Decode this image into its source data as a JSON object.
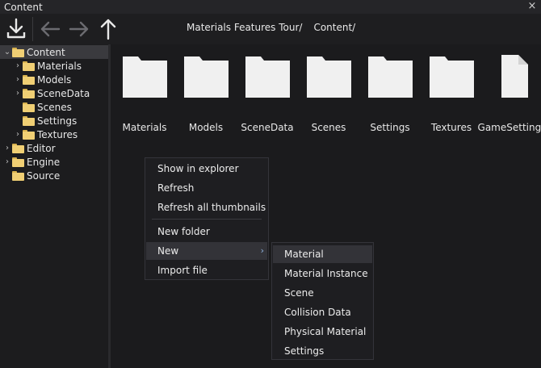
{
  "window": {
    "title": "Content",
    "close_glyph": "×"
  },
  "toolbar": {
    "icons": [
      "import-icon",
      "arrow-left-icon",
      "arrow-right-icon",
      "arrow-up-icon"
    ],
    "breadcrumbs": [
      "Materials Features Tour/",
      "Content/"
    ]
  },
  "tree": [
    {
      "label": "Content",
      "expanded": true,
      "selected": true
    },
    {
      "label": "Materials"
    },
    {
      "label": "Models"
    },
    {
      "label": "SceneData"
    },
    {
      "label": "Scenes"
    },
    {
      "label": "Settings"
    },
    {
      "label": "Textures"
    },
    {
      "label": "Editor"
    },
    {
      "label": "Engine"
    },
    {
      "label": "Source"
    }
  ],
  "items": [
    {
      "label": "Materials",
      "kind": "folder"
    },
    {
      "label": "Models",
      "kind": "folder"
    },
    {
      "label": "SceneData",
      "kind": "folder"
    },
    {
      "label": "Scenes",
      "kind": "folder"
    },
    {
      "label": "Settings",
      "kind": "folder"
    },
    {
      "label": "Textures",
      "kind": "folder"
    },
    {
      "label": "GameSettings",
      "kind": "file"
    }
  ],
  "context_menu": {
    "items": [
      "Show in explorer",
      "Refresh",
      "Refresh all thumbnails",
      "New folder",
      "New",
      "Import file"
    ],
    "highlighted": "New"
  },
  "submenu": {
    "items": [
      "Material",
      "Material Instance",
      "Scene",
      "Collision Data",
      "Physical Material",
      "Settings"
    ],
    "highlighted": "Material"
  },
  "colors": {
    "folder": "#f0cf74",
    "thumb": "#f0f0f0",
    "accent": "#8fb3e0"
  }
}
